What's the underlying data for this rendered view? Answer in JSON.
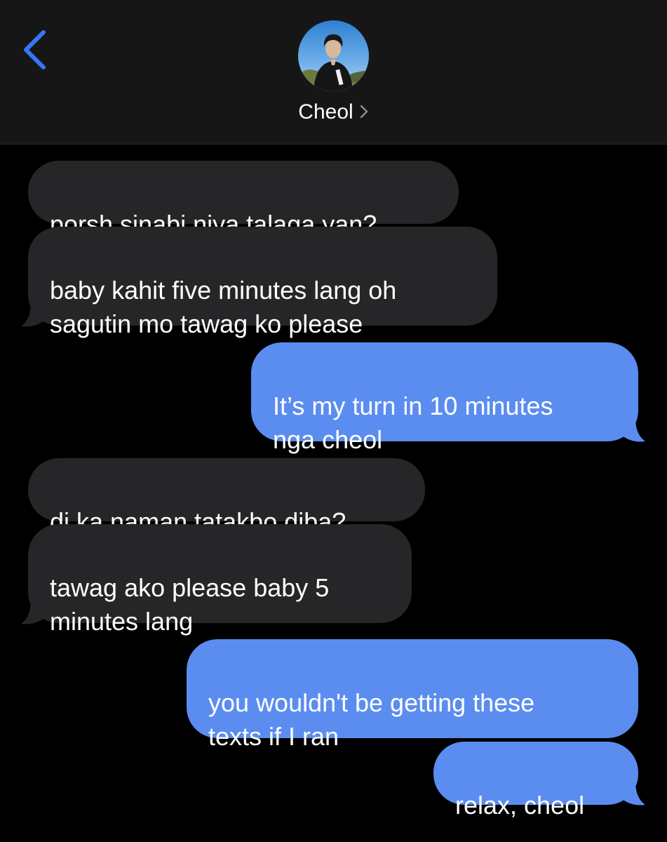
{
  "header": {
    "contact_name": "Cheol",
    "back_icon": "chevron-left-icon",
    "accent_color": "#3478f6"
  },
  "colors": {
    "received_bubble": "#262629",
    "sent_bubble": "#5b8df0",
    "background": "#000000",
    "header_background": "#161616"
  },
  "messages": [
    {
      "direction": "received",
      "text": "porsh sinabi niya talaga yan?"
    },
    {
      "direction": "received",
      "text": "baby kahit five minutes lang oh\nsagutin mo tawag ko please"
    },
    {
      "direction": "sent",
      "text": "It’s my turn in 10 minutes\nnga cheol"
    },
    {
      "direction": "received",
      "text": "di ka naman tatakbo diba?"
    },
    {
      "direction": "received",
      "text": "tawag ako please baby 5\nminutes lang"
    },
    {
      "direction": "sent",
      "text": "you wouldn't be getting these\ntexts if I ran"
    },
    {
      "direction": "sent",
      "text": "relax, cheol"
    }
  ]
}
